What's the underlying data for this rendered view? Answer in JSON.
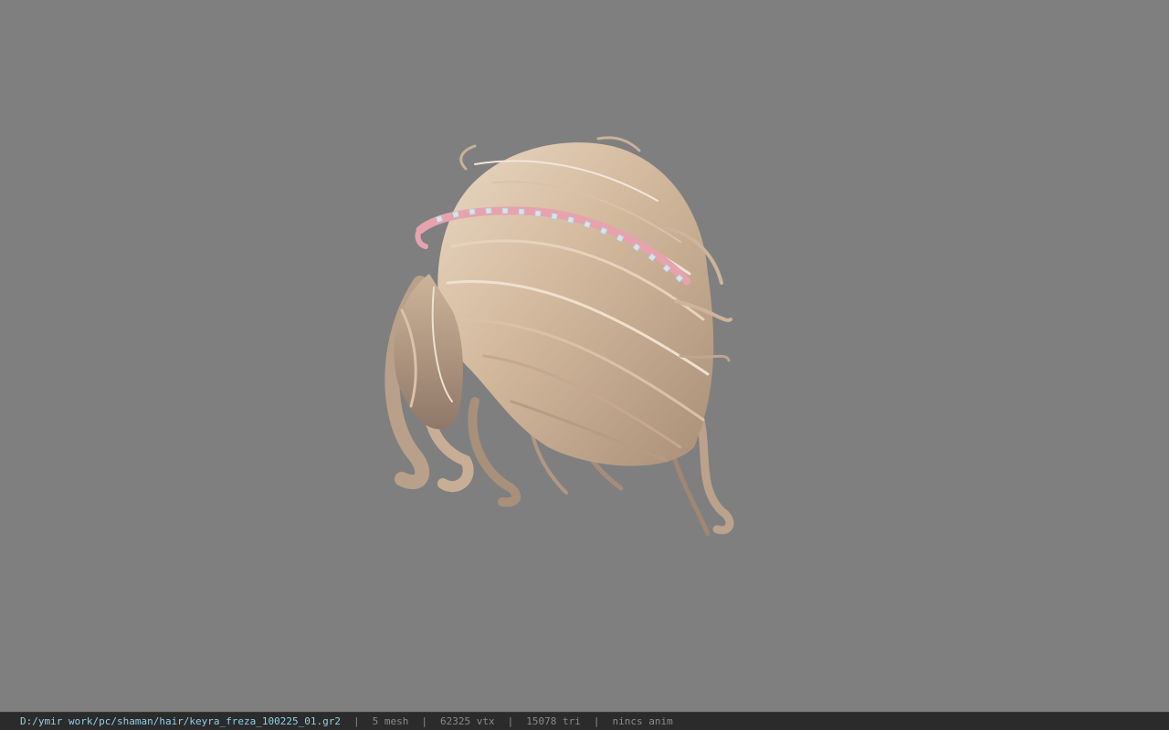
{
  "viewport": {
    "background": "#7f7f7f",
    "subject": "hair-model"
  },
  "statusbar": {
    "path": "D:/ymir work/pc/shaman/hair/keyra_freza_100225_01.gr2",
    "separator": "|",
    "mesh": "5 mesh",
    "vertices": "62325 vtx",
    "triangles": "15078 tri",
    "anim": "nincs anim"
  },
  "colors": {
    "path_text": "#8fd0e8",
    "info_text": "#8a8a8a",
    "statusbar_bg": "#2b2b2b",
    "hair": "#d6bfa5",
    "headband": "#e7a3ad"
  }
}
